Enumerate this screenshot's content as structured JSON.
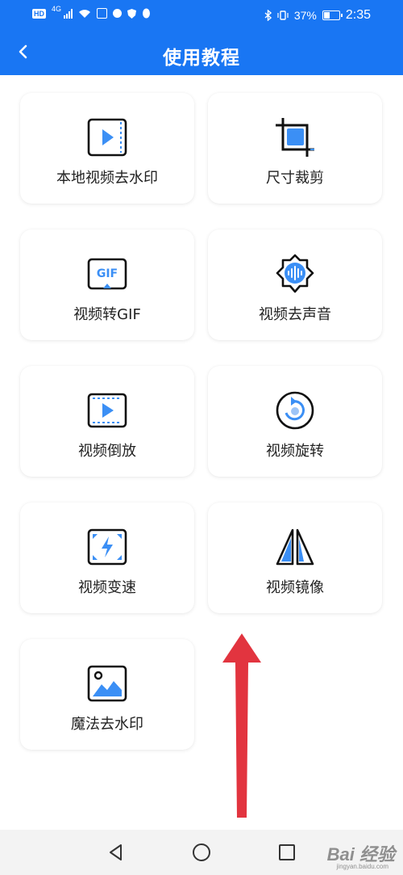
{
  "status_bar": {
    "left_badge": "HD",
    "network": "4G",
    "battery": "37%",
    "time": "2:35"
  },
  "header": {
    "title": "使用教程"
  },
  "tutorials": [
    {
      "label": "本地视频去水印",
      "icon": "video-file-icon"
    },
    {
      "label": "尺寸裁剪",
      "icon": "crop-icon"
    },
    {
      "label": "视频转GIF",
      "icon": "gif-icon"
    },
    {
      "label": "视频去声音",
      "icon": "audio-wave-icon"
    },
    {
      "label": "视频倒放",
      "icon": "video-play-icon"
    },
    {
      "label": "视频旋转",
      "icon": "rotate-icon"
    },
    {
      "label": "视频变速",
      "icon": "speed-icon"
    },
    {
      "label": "视频镜像",
      "icon": "mirror-icon"
    },
    {
      "label": "魔法去水印",
      "icon": "image-icon"
    }
  ],
  "watermark": {
    "text": "Bai 经验",
    "sub": "jingyan.baidu.com"
  },
  "colors": {
    "primary": "#1976f3",
    "icon_blue": "#3b8ff5",
    "annotation": "#e2343f"
  }
}
